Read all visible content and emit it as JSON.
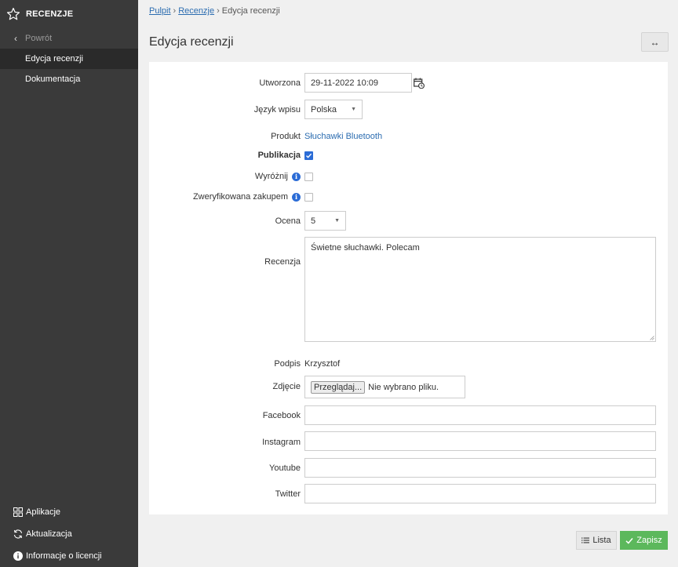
{
  "sidebar": {
    "title": "RECENZJE",
    "back_label": "Powrót",
    "items": [
      {
        "label": "Edycja recenzji",
        "active": true
      },
      {
        "label": "Dokumentacja",
        "active": false
      }
    ],
    "bottom_items": [
      {
        "label": "Aplikacje",
        "icon": "grid-icon"
      },
      {
        "label": "Aktualizacja",
        "icon": "refresh-icon"
      },
      {
        "label": "Informacje o licencji",
        "icon": "info-icon"
      }
    ]
  },
  "breadcrumb": [
    "Pulpit",
    "Recenzje",
    "Edycja recenzji"
  ],
  "page_title": "Edycja recenzji",
  "expand_label": "↔",
  "form": {
    "created_label": "Utworzona",
    "created_value": "29-11-2022 10:09",
    "language_label": "Język wpisu",
    "language_value": "Polska",
    "product_label": "Produkt",
    "product_value": "Słuchawki Bluetooth",
    "publication_label": "Publikacja",
    "publication_checked": true,
    "highlight_label": "Wyróżnij",
    "highlight_checked": false,
    "verified_label": "Zweryfikowana zakupem",
    "verified_checked": false,
    "rating_label": "Ocena",
    "rating_value": "5",
    "review_label": "Recenzja",
    "review_value": "Świetne słuchawki. Polecam",
    "signature_label": "Podpis",
    "signature_value": "Krzysztof",
    "photo_label": "Zdjęcie",
    "photo_button": "Przeglądaj...",
    "photo_status": "Nie wybrano pliku.",
    "facebook_label": "Facebook",
    "facebook_value": "",
    "instagram_label": "Instagram",
    "instagram_value": "",
    "youtube_label": "Youtube",
    "youtube_value": "",
    "twitter_label": "Twitter",
    "twitter_value": ""
  },
  "actions": {
    "list_label": "Lista",
    "save_label": "Zapisz"
  },
  "colors": {
    "sidebar_bg": "#3a3a3a",
    "accent_blue": "#2b6cd6",
    "save_green": "#5cb85c"
  }
}
